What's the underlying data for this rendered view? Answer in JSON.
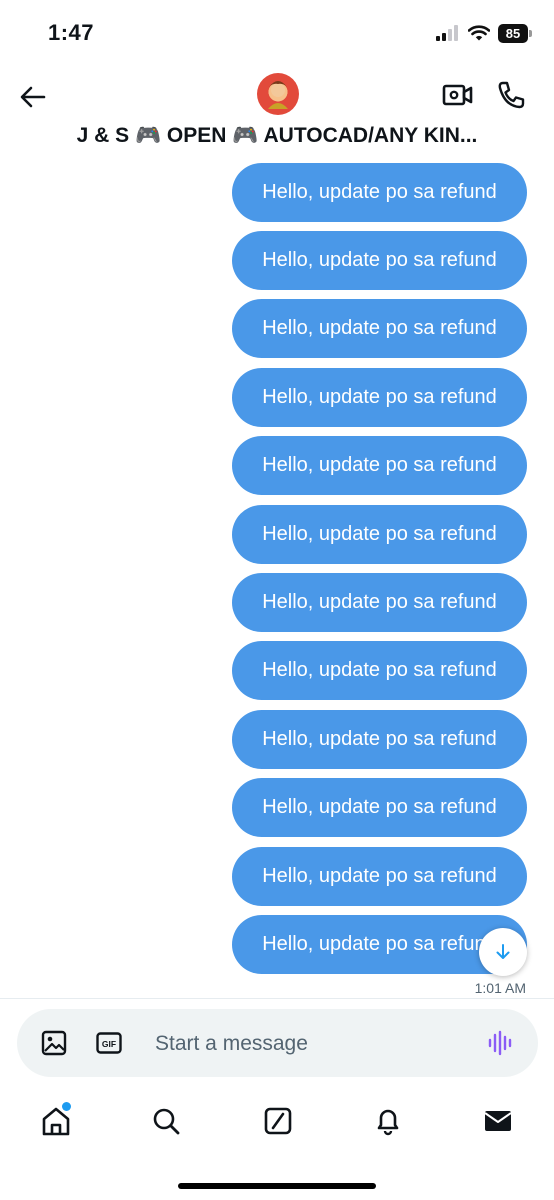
{
  "status_bar": {
    "time": "1:47",
    "battery": "85"
  },
  "header": {
    "title": "J & S 🎮 OPEN 🎮 AUTOCAD/ANY KIN...",
    "back_icon": "arrow-left-icon",
    "video_icon": "video-camera-icon",
    "phone_icon": "phone-icon"
  },
  "messages": [
    {
      "text": "Hello, update po sa refund"
    },
    {
      "text": "Hello, update po sa refund"
    },
    {
      "text": "Hello, update po sa refund"
    },
    {
      "text": "Hello, update po sa refund"
    },
    {
      "text": "Hello, update po sa refund"
    },
    {
      "text": "Hello, update po sa refund"
    },
    {
      "text": "Hello, update po sa refund"
    },
    {
      "text": "Hello, update po sa refund"
    },
    {
      "text": "Hello, update po sa refund"
    },
    {
      "text": "Hello, update po sa refund"
    },
    {
      "text": "Hello, update po sa refund"
    },
    {
      "text": "Hello, update po sa refund"
    }
  ],
  "last_timestamp": "1:01 AM",
  "composer": {
    "placeholder": "Start a message",
    "gif_label": "GIF",
    "image_icon": "image-icon",
    "voice_icon": "voice-wave-icon"
  },
  "tab_bar": {
    "items": [
      "home-icon",
      "search-icon",
      "grok-icon",
      "bell-icon",
      "mail-icon"
    ]
  },
  "colors": {
    "bubble": "#4a98e8",
    "accent": "#1d9bf0",
    "voice": "#8b5cf6"
  }
}
